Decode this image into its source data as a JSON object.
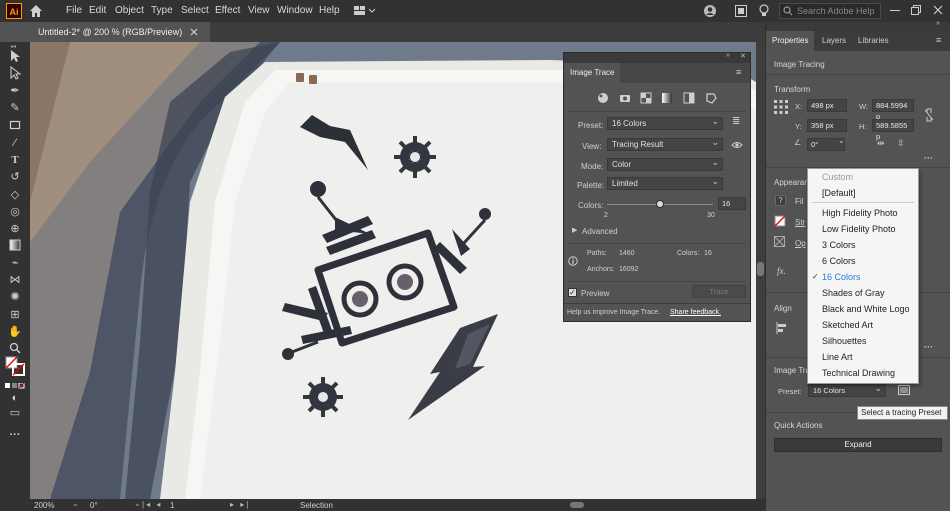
{
  "app": {
    "logo": "Ai"
  },
  "menu": [
    "File",
    "Edit",
    "Object",
    "Type",
    "Select",
    "Effect",
    "View",
    "Window",
    "Help"
  ],
  "search": {
    "placeholder": "Search Adobe Help"
  },
  "document": {
    "tab_title": "Untitled-2* @ 200 % (RGB/Preview)"
  },
  "status": {
    "zoom": "200%",
    "rotation": "0°",
    "artboard": "1",
    "tool": "Selection"
  },
  "image_trace_panel": {
    "tab": "Image Trace",
    "preset_label": "Preset:",
    "preset_value": "16 Colors",
    "view_label": "View:",
    "view_value": "Tracing Result",
    "mode_label": "Mode:",
    "mode_value": "Color",
    "palette_label": "Palette:",
    "palette_value": "Limited",
    "colors_label": "Colors:",
    "colors_value": "16",
    "colors_min": "2",
    "colors_max": "30",
    "colors_slider_fraction": 0.5,
    "advanced_label": "Advanced",
    "paths_label": "Paths:",
    "paths_value": "1460",
    "colors_stat_label": "Colors:",
    "colors_stat_value": "16",
    "anchors_label": "Anchors:",
    "anchors_value": "16092",
    "preview_label": "Preview",
    "trace_button": "Trace",
    "footer_text": "Help us improve Image Trace.",
    "footer_link": "Share feedback."
  },
  "properties": {
    "tabs": [
      "Properties",
      "Layers",
      "Libraries"
    ],
    "object_type": "Image Tracing",
    "transform_title": "Transform",
    "x_label": "X:",
    "x_value": "498 px",
    "y_label": "Y:",
    "y_value": "358 px",
    "w_label": "W:",
    "w_value": "884.5994 p",
    "h_label": "H:",
    "h_value": "589.5855 p",
    "angle_value": "0°",
    "appearance_title": "Appearanc",
    "fill_label": "Fil",
    "stroke_label": "Str",
    "opacity_label": "Op",
    "fx_label": "fx.",
    "align_title": "Align",
    "image_trace_title": "Image Tra",
    "preset_label": "Preset:",
    "preset_value": "16 Colors",
    "quick_actions_title": "Quick Actions",
    "expand_button": "Expand"
  },
  "preset_dropdown": {
    "options": [
      "Custom",
      "[Default]",
      "High Fidelity Photo",
      "Low Fidelity Photo",
      "3 Colors",
      "6 Colors",
      "16 Colors",
      "Shades of Gray",
      "Black and White Logo",
      "Sketched Art",
      "Silhouettes",
      "Line Art",
      "Technical Drawing"
    ],
    "selected": "16 Colors",
    "disabled": "Custom"
  },
  "tooltip": "Select a tracing Preset"
}
